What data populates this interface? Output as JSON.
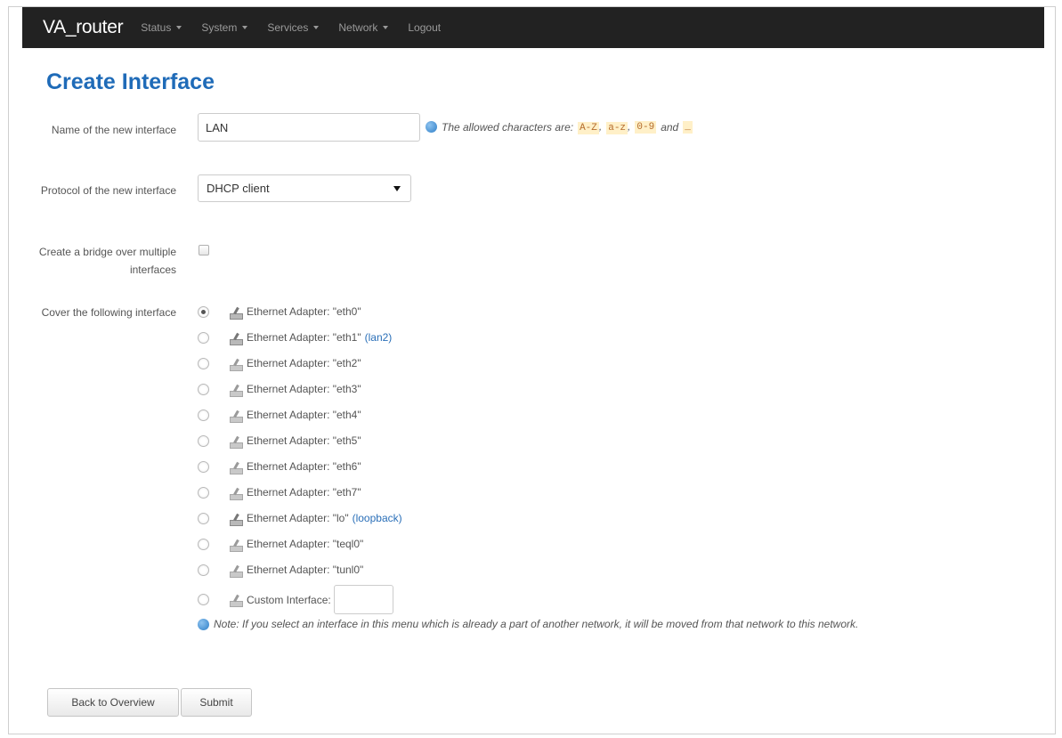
{
  "navbar": {
    "brand": "VA_router",
    "menu": [
      {
        "label": "Status",
        "has_caret": true
      },
      {
        "label": "System",
        "has_caret": true
      },
      {
        "label": "Services",
        "has_caret": true
      },
      {
        "label": "Network",
        "has_caret": true
      },
      {
        "label": "Logout",
        "has_caret": false
      }
    ]
  },
  "page": {
    "title": "Create Interface"
  },
  "form": {
    "name": {
      "label": "Name of the new interface",
      "value": "LAN",
      "hint_prefix": "The allowed characters are:",
      "hint_codes": [
        "A-Z",
        "a-z",
        "0-9",
        "_"
      ],
      "hint_sep1": ",",
      "hint_sep2": ",",
      "hint_and": "and"
    },
    "protocol": {
      "label": "Protocol of the new interface",
      "value": "DHCP client"
    },
    "bridge": {
      "label": "Create a bridge over multiple interfaces",
      "checked": false
    },
    "cover": {
      "label": "Cover the following interface",
      "interfaces": [
        {
          "label": "Ethernet Adapter: \"eth0\"",
          "link": "",
          "checked": true
        },
        {
          "label": "Ethernet Adapter: \"eth1\"",
          "link": "(lan2)",
          "checked": false
        },
        {
          "label": "Ethernet Adapter: \"eth2\"",
          "link": "",
          "checked": false
        },
        {
          "label": "Ethernet Adapter: \"eth3\"",
          "link": "",
          "checked": false
        },
        {
          "label": "Ethernet Adapter: \"eth4\"",
          "link": "",
          "checked": false
        },
        {
          "label": "Ethernet Adapter: \"eth5\"",
          "link": "",
          "checked": false
        },
        {
          "label": "Ethernet Adapter: \"eth6\"",
          "link": "",
          "checked": false
        },
        {
          "label": "Ethernet Adapter: \"eth7\"",
          "link": "",
          "checked": false
        },
        {
          "label": "Ethernet Adapter: \"lo\"",
          "link": "(loopback)",
          "checked": false
        },
        {
          "label": "Ethernet Adapter: \"teql0\"",
          "link": "",
          "checked": false
        },
        {
          "label": "Ethernet Adapter: \"tunl0\"",
          "link": "",
          "checked": false
        }
      ],
      "custom_label": "Custom Interface:",
      "custom_value": ""
    },
    "note": "Note: If you select an interface in this menu which is already a part of another network, it will be moved from that network to this network."
  },
  "buttons": {
    "back": "Back to Overview",
    "submit": "Submit"
  }
}
